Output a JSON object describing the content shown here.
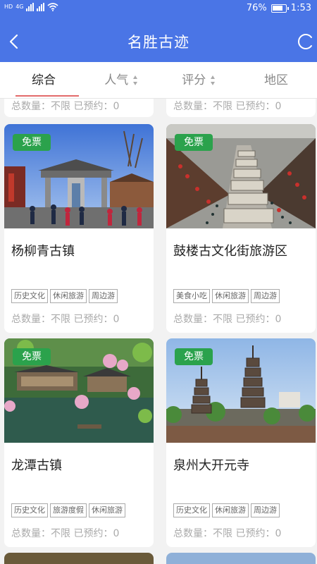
{
  "status_bar": {
    "left_chip_1": "HD",
    "left_chip_2": "4G",
    "battery": "76%",
    "time": "1:53"
  },
  "header": {
    "title": "名胜古迹",
    "bg_color": "#4a75e6"
  },
  "tabs": [
    {
      "label": "综合",
      "active": true
    },
    {
      "label": "人气",
      "active": false
    },
    {
      "label": "评分",
      "active": false
    },
    {
      "label": "地区",
      "active": false
    }
  ],
  "previous_row_stats": {
    "left": "总数量：不限 已预约：0",
    "right": "总数量：不限 已预约：0"
  },
  "cards": [
    {
      "badge": "免票",
      "title": "杨柳青古镇",
      "tags": [
        "历史文化",
        "休闲旅游",
        "周边游"
      ],
      "stats": "总数量：不限 已预约：0",
      "image": "archway-square-photo"
    },
    {
      "badge": "免票",
      "title": "鼓楼古文化街旅游区",
      "tags": [
        "美食小吃",
        "休闲旅游",
        "周边游"
      ],
      "stats": "总数量：不限 已预约：0",
      "image": "market-street-photo"
    },
    {
      "badge": "免票",
      "title": "龙潭古镇",
      "tags": [
        "历史文化",
        "旅游度假",
        "休闲旅游"
      ],
      "stats": "总数量：不限 已预约：0",
      "image": "lake-pavilion-photo"
    },
    {
      "badge": "免票",
      "title": "泉州大开元寺",
      "tags": [
        "历史文化",
        "休闲旅游",
        "周边游"
      ],
      "stats": "总数量：不限 已预约：0",
      "image": "twin-pagodas-photo"
    }
  ],
  "colors": {
    "badge_green": "#2ba24c",
    "tab_underline": "#e36a6a"
  }
}
